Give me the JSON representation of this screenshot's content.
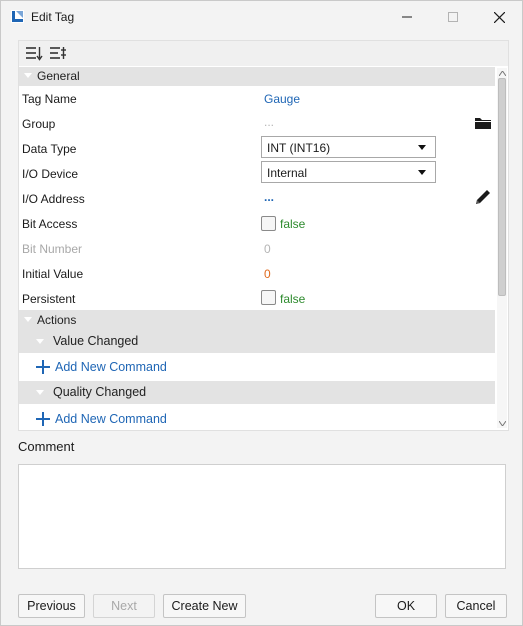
{
  "window": {
    "title": "Edit Tag"
  },
  "categories": {
    "general": "General",
    "actions": "Actions",
    "value_changed": "Value Changed",
    "quality_changed": "Quality Changed"
  },
  "properties": {
    "tag_name": {
      "label": "Tag Name",
      "value": "Gauge"
    },
    "group": {
      "label": "Group",
      "value": "..."
    },
    "data_type": {
      "label": "Data Type",
      "value": "INT (INT16)"
    },
    "io_device": {
      "label": "I/O Device",
      "value": "Internal"
    },
    "io_address": {
      "label": "I/O Address",
      "value": "..."
    },
    "bit_access": {
      "label": "Bit Access",
      "value": "false"
    },
    "bit_number": {
      "label": "Bit Number",
      "value": "0"
    },
    "initial_value": {
      "label": "Initial Value",
      "value": "0"
    },
    "persistent": {
      "label": "Persistent",
      "value": "false"
    }
  },
  "actions": {
    "add_command_label": "Add New Command"
  },
  "comment": {
    "label": "Comment",
    "value": ""
  },
  "buttons": {
    "previous": "Previous",
    "next": "Next",
    "create_new": "Create New",
    "ok": "OK",
    "cancel": "Cancel"
  },
  "icons": {
    "app": "app-logo-icon",
    "sort_categorized": "sort-categorized-icon",
    "sort_alphabetical": "sort-alphabetical-icon",
    "folder": "folder-icon",
    "edit": "pencil-icon",
    "add": "plus-icon"
  },
  "colors": {
    "link_blue": "#1f66b5",
    "bool_green": "#2e8b2e",
    "number_orange": "#e06a1d",
    "category_gray": "#e3e3e3"
  }
}
